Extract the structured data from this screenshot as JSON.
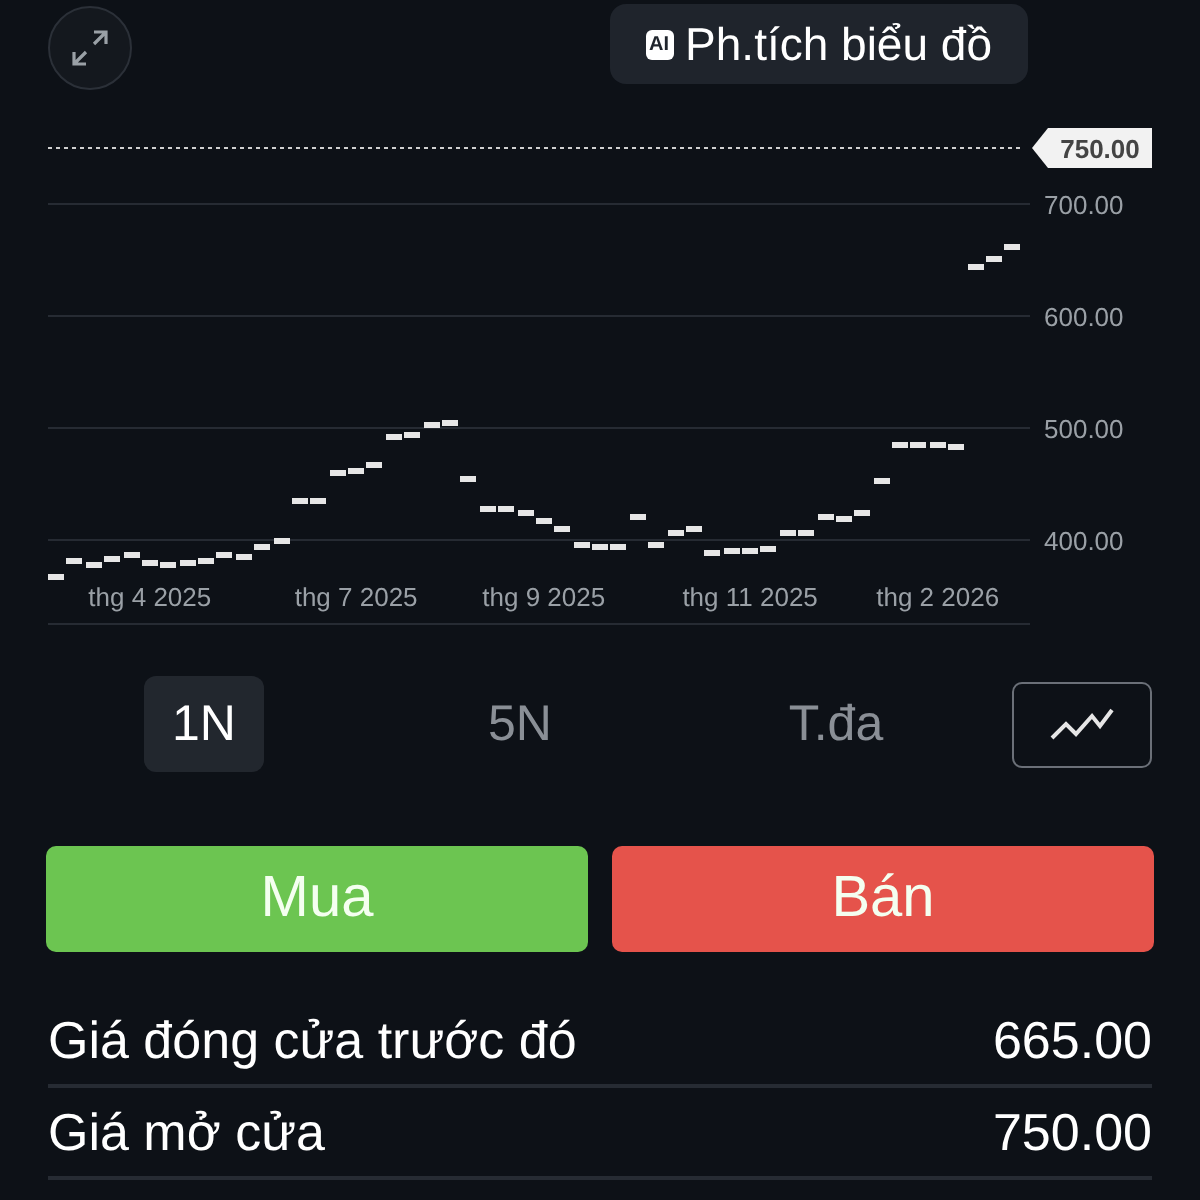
{
  "top_bar": {
    "analysis_button": {
      "badge": "AI",
      "label": "Ph.tích biểu đồ"
    }
  },
  "chart_data": {
    "type": "scatter",
    "categories": [
      null,
      null,
      null,
      null,
      null,
      "thg 4 2025",
      null,
      null,
      null,
      null,
      null,
      null,
      null,
      null,
      null,
      null,
      "thg 7 2025",
      null,
      null,
      null,
      null,
      null,
      null,
      null,
      null,
      null,
      "thg 9 2025",
      null,
      null,
      null,
      null,
      null,
      null,
      null,
      null,
      null,
      null,
      "thg 11 2025",
      null,
      null,
      null,
      null,
      null,
      null,
      null,
      null,
      null,
      "thg 2 2026",
      null,
      null,
      null,
      null
    ],
    "series": [
      {
        "color": "#e6e6e6",
        "values": [
          367,
          381,
          378,
          383,
          386,
          379,
          377,
          379,
          381,
          386,
          384,
          393,
          400,
          434,
          434,
          459,
          461,
          467,
          492,
          493,
          503,
          505,
          454,
          427,
          427,
          424,
          417,
          409,
          396,
          394,
          394,
          420,
          396,
          407,
          410,
          389,
          391,
          390,
          392,
          407,
          407,
          421,
          419,
          425,
          452,
          485,
          485,
          485,
          483,
          644,
          651,
          661
        ]
      }
    ],
    "grid": true,
    "ylim": [
      325,
      750
    ],
    "yticks": [
      {
        "value": 400,
        "label": "400.00"
      },
      {
        "value": 500,
        "label": "500.00"
      },
      {
        "value": 600,
        "label": "600.00"
      },
      {
        "value": 700,
        "label": "700.00"
      }
    ],
    "ref_lines": [
      {
        "axis": "y",
        "value": 750,
        "label": "750.00"
      }
    ]
  },
  "ranges": [
    {
      "label": "1N",
      "selected": true
    },
    {
      "label": "5N",
      "selected": false
    },
    {
      "label": "T.đa",
      "selected": false
    }
  ],
  "actions": [
    {
      "kind": "buy",
      "label": "Mua"
    },
    {
      "kind": "sell",
      "label": "Bán"
    }
  ],
  "stats": [
    {
      "label": "Giá đóng cửa trước đó",
      "value": "665.00"
    },
    {
      "label": "Giá mở cửa",
      "value": "750.00"
    }
  ]
}
